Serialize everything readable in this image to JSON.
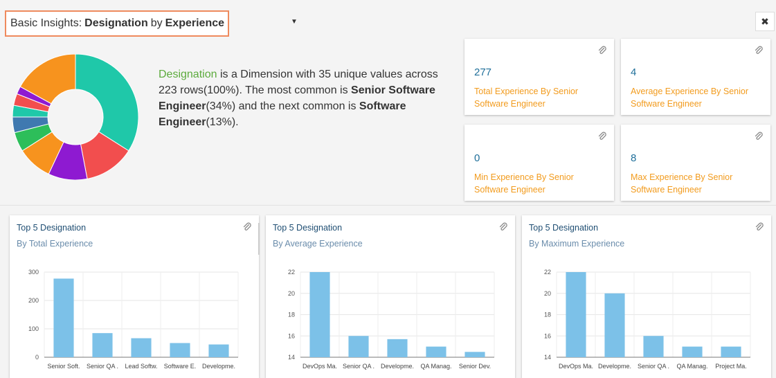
{
  "header": {
    "prefix": "Basic Insights:",
    "dimension": "Designation",
    "by": "by",
    "measure": "Experience",
    "caret": "▼",
    "close": "✖"
  },
  "summary": {
    "dimension": "Designation",
    "sentence_1": " is a Dimension with 35 unique values across 223 rows(100%). The most common is ",
    "most_common": "Senior Software Engineer",
    "sentence_2": "(34%) and the next common is ",
    "next_common": "Software Engineer",
    "sentence_3": "(13%)."
  },
  "donut": {
    "slices": [
      {
        "value": 34,
        "color": "#1fc8a9"
      },
      {
        "value": 13,
        "color": "#f24e4e"
      },
      {
        "value": 10,
        "color": "#8e1ad1"
      },
      {
        "value": 9,
        "color": "#f7931e"
      },
      {
        "value": 5,
        "color": "#2dbe5a"
      },
      {
        "value": 4,
        "color": "#3f79b0"
      },
      {
        "value": 3,
        "color": "#1fc8a9"
      },
      {
        "value": 3,
        "color": "#f24e4e"
      },
      {
        "value": 2,
        "color": "#8e1ad1"
      },
      {
        "value": 17,
        "color": "#f7931e"
      }
    ]
  },
  "kpis": [
    {
      "value": "277",
      "label": "Total Experience By Senior Software Engineer"
    },
    {
      "value": "4",
      "label": "Average Experience By Senior Software Engineer"
    },
    {
      "value": "0",
      "label": "Min Experience By Senior Software Engineer"
    },
    {
      "value": "8",
      "label": "Max Experience By Senior Software Engineer"
    }
  ],
  "colors": {
    "bar": "#7cc1e8",
    "kpi_value": "#1f6f9a",
    "kpi_label": "#f29b1d",
    "highlight_border": "#ef8a5d"
  },
  "cards": [
    {
      "title": "Top 5 Designation",
      "subtitle": "By Total Experience"
    },
    {
      "title": "Top 5 Designation",
      "subtitle": "By Average Experience"
    },
    {
      "title": "Top 5 Designation",
      "subtitle": "By Maximum Experience"
    }
  ],
  "chart_data": [
    {
      "type": "bar",
      "categories": [
        "Senior Soft.",
        "Senior QA .",
        "Lead Softw.",
        "Software E.",
        "Developme."
      ],
      "values": [
        277,
        85,
        67,
        50,
        45
      ],
      "ylim": [
        0,
        300
      ],
      "yticks": [
        0,
        100,
        200,
        300
      ],
      "title": "Top 5 Designation",
      "subtitle": "By Total Experience"
    },
    {
      "type": "bar",
      "categories": [
        "DevOps Ma.",
        "Senior QA .",
        "Developme.",
        "QA Manag.",
        "Senior Dev."
      ],
      "values": [
        22,
        16,
        15.7,
        15,
        14.5
      ],
      "ylim": [
        14,
        22
      ],
      "yticks": [
        14,
        16,
        18,
        20,
        22
      ],
      "title": "Top 5 Designation",
      "subtitle": "By Average Experience"
    },
    {
      "type": "bar",
      "categories": [
        "DevOps Ma.",
        "Developme.",
        "Senior QA .",
        "QA Manag.",
        "Project Ma."
      ],
      "values": [
        22,
        20,
        16,
        15,
        15
      ],
      "ylim": [
        14,
        22
      ],
      "yticks": [
        14,
        16,
        18,
        20,
        22
      ],
      "title": "Top 5 Designation",
      "subtitle": "By Maximum Experience"
    }
  ]
}
